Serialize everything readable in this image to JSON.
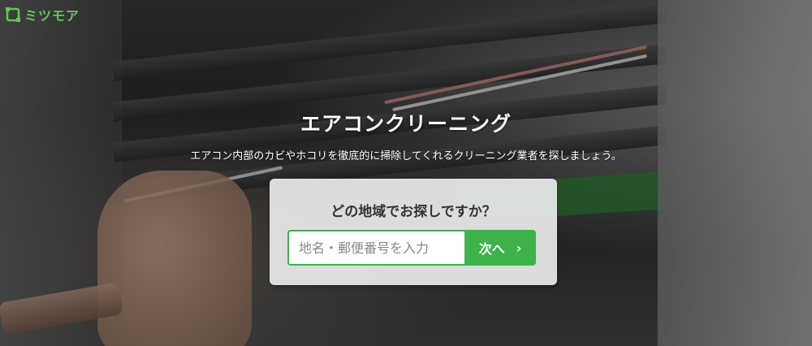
{
  "brand": {
    "name": "ミツモア",
    "color": "#62c95a"
  },
  "hero": {
    "title": "エアコンクリーニング",
    "subtitle": "エアコン内部のカビやホコリを徹底的に掃除してくれるクリーニング業者を探しましょう。"
  },
  "search": {
    "question": "どの地域でお探しですか？",
    "placeholder": "地名・郵便番号を入力",
    "value": "",
    "button_label": "次へ",
    "button_icon": "chevron-right-icon",
    "accent": "#3db24a"
  }
}
